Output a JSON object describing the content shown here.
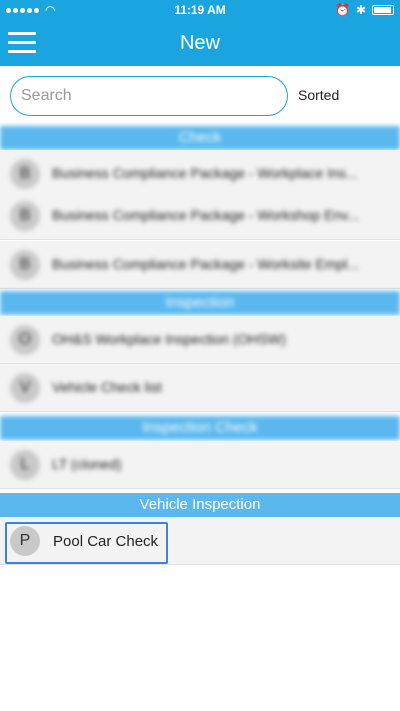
{
  "status_bar": {
    "time": "11:19 AM"
  },
  "nav": {
    "title": "New",
    "menu_icon": "hamburger-icon"
  },
  "search": {
    "placeholder": "Search",
    "value": "",
    "sort_label": "Sorted"
  },
  "sections": [
    {
      "header": "Check",
      "items": [
        {
          "initial": "B",
          "label": "Business Compliance Package - Workplace Ins..."
        },
        {
          "initial": "B",
          "label": "Business Compliance Package - Workshop Env..."
        },
        {
          "initial": "B",
          "label": "Business Compliance Package - Worksite Empl..."
        }
      ]
    },
    {
      "header": "Inspection",
      "items": [
        {
          "initial": "O",
          "label": "OH&S Workplace Inspection (OHSW)"
        },
        {
          "initial": "V",
          "label": "Vehicle Check list"
        }
      ]
    },
    {
      "header": "Inspection Check",
      "items": [
        {
          "initial": "L",
          "label": "LT (cloned)"
        }
      ]
    },
    {
      "header": "Vehicle Inspection",
      "items": [
        {
          "initial": "P",
          "label": "Pool Car Check"
        }
      ]
    }
  ],
  "colors": {
    "accent": "#1ba5e0",
    "section_header": "#5ab8ee",
    "selection_border": "#3b82e0"
  }
}
